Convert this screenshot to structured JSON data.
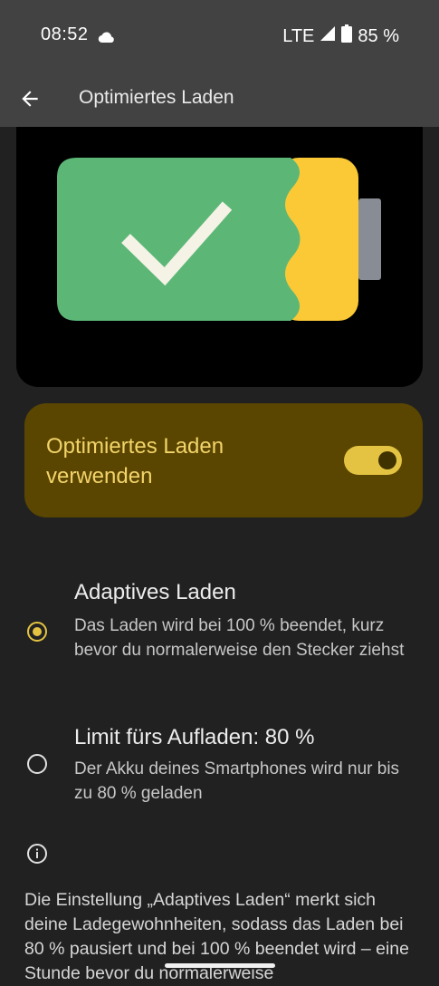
{
  "status_bar": {
    "time": "08:52",
    "network": "LTE",
    "battery": "85 %",
    "icons": [
      "cloud-icon",
      "signal-icon",
      "battery-icon"
    ]
  },
  "app_bar": {
    "title": "Optimiertes Laden",
    "back_icon": "arrow-back-icon"
  },
  "illustration": {
    "icon": "battery-check-icon",
    "colors": {
      "fill": "#5cb777",
      "charge": "#fbc935",
      "terminal": "#888c94",
      "check": "#f5f2e6"
    }
  },
  "toggle": {
    "label": "Optimiertes Laden verwenden",
    "on": true
  },
  "options": [
    {
      "title": "Adaptives Laden",
      "description": "Das Laden wird bei 100 % beendet, kurz bevor du normalerweise den Stecker ziehst",
      "selected": true
    },
    {
      "title": "Limit fürs Aufladen: 80 %",
      "description": "Der Akku deines Smartphones wird nur bis zu 80 % geladen",
      "selected": false
    }
  ],
  "info": {
    "icon": "info-icon",
    "text": "Die Einstellung „Adaptives Laden“ merkt sich deine Ladegewohnheiten, sodass das Laden bei 80 % pausiert und bei 100 % beendet wird – eine Stunde bevor du normalerweise"
  },
  "colors": {
    "accent": "#e4c342",
    "card": "#5a4600",
    "background": "#212121",
    "bar": "#424242"
  }
}
